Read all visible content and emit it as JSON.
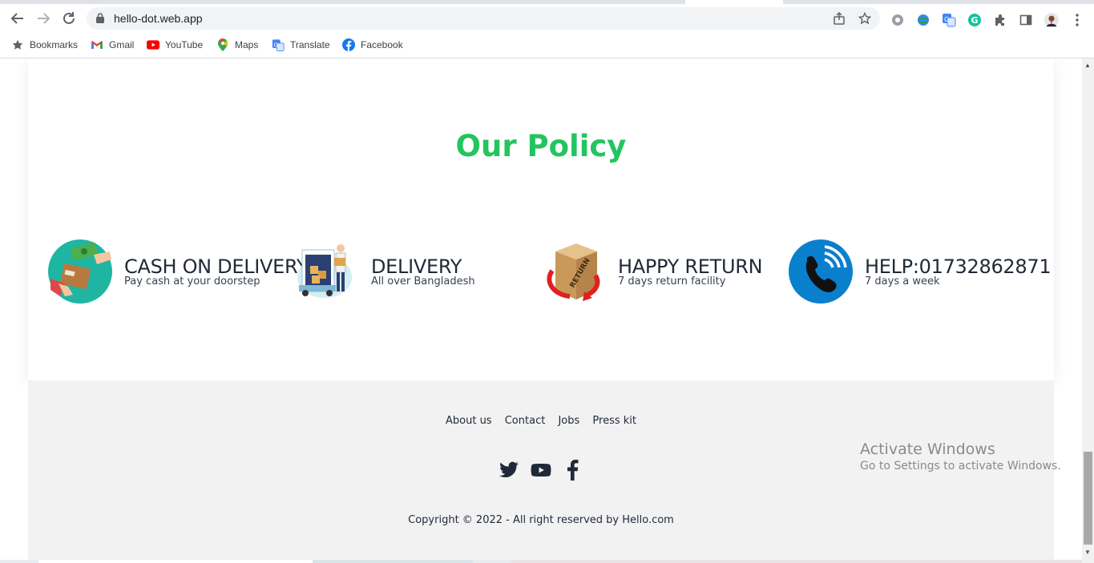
{
  "browser": {
    "url": "hello-dot.web.app",
    "bookmarks": [
      {
        "label": "Bookmarks",
        "icon": "star-icon"
      },
      {
        "label": "Gmail",
        "icon": "gmail-icon"
      },
      {
        "label": "YouTube",
        "icon": "youtube-icon"
      },
      {
        "label": "Maps",
        "icon": "maps-icon"
      },
      {
        "label": "Translate",
        "icon": "translate-icon"
      },
      {
        "label": "Facebook",
        "icon": "facebook-icon"
      }
    ]
  },
  "policy": {
    "title": "Our Policy",
    "items": [
      {
        "title": "CASH ON DELIVERY",
        "subtitle": "Pay cash at your doorstep",
        "icon": "cash-on-delivery-icon"
      },
      {
        "title": "DELIVERY",
        "subtitle": "All over Bangladesh",
        "icon": "delivery-truck-icon"
      },
      {
        "title": "HAPPY RETURN",
        "subtitle": "7 days return facility",
        "icon": "return-box-icon",
        "box_label": "RETURN"
      },
      {
        "title": "HELP:01732862871",
        "subtitle": "7 days a week",
        "icon": "phone-icon"
      }
    ]
  },
  "footer": {
    "links": [
      "About us",
      "Contact",
      "Jobs",
      "Press kit"
    ],
    "social": [
      "twitter-icon",
      "youtube-icon",
      "facebook-icon"
    ],
    "copyright": "Copyright © 2022 - All right reserved by Hello.com"
  },
  "watermark": {
    "line1": "Activate Windows",
    "line2": "Go to Settings to activate Windows."
  },
  "colors": {
    "accent": "#22c55e",
    "text": "#1f2937",
    "footer_bg": "#f2f2f2"
  }
}
